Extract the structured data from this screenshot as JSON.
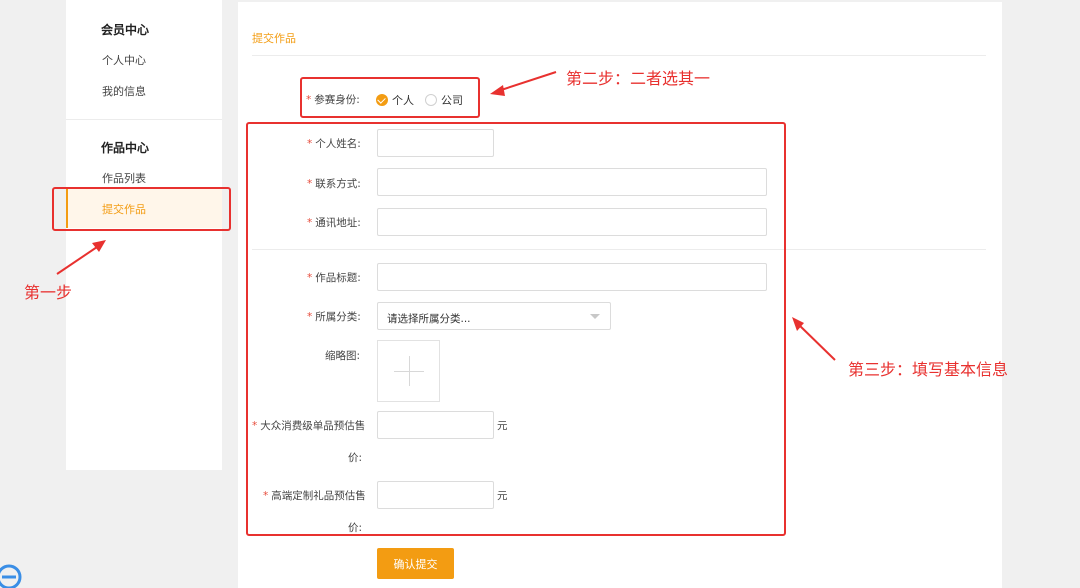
{
  "sidebar": {
    "member_center_title": "会员中心",
    "personal_center": "个人中心",
    "my_info": "我的信息",
    "works_center_title": "作品中心",
    "works_list": "作品列表",
    "submit_work": "提交作品"
  },
  "main": {
    "title": "提交作品",
    "identity": {
      "label": "参赛身份:",
      "options": [
        "个人",
        "公司"
      ],
      "selected": "个人"
    },
    "fields": {
      "name": "个人姓名:",
      "contact": "联系方式:",
      "address": "通讯地址:",
      "work_title": "作品标题:",
      "category": "所属分类:",
      "category_placeholder": "请选择所属分类...",
      "thumbnail": "缩略图:",
      "price_mass_line1": "大众消费级单品预估售",
      "price_mass_line2": "价:",
      "price_custom_line1": "高端定制礼品预估售",
      "price_custom_line2": "价:",
      "unit": "元"
    },
    "submit_label": "确认提交"
  },
  "annotations": {
    "step1": "第一步",
    "step2": "第二步：二者选其一",
    "step3": "第三步：填写基本信息",
    "color": "#e8312f"
  },
  "colors": {
    "accent": "#f39c12",
    "required": "#e74c3c"
  }
}
